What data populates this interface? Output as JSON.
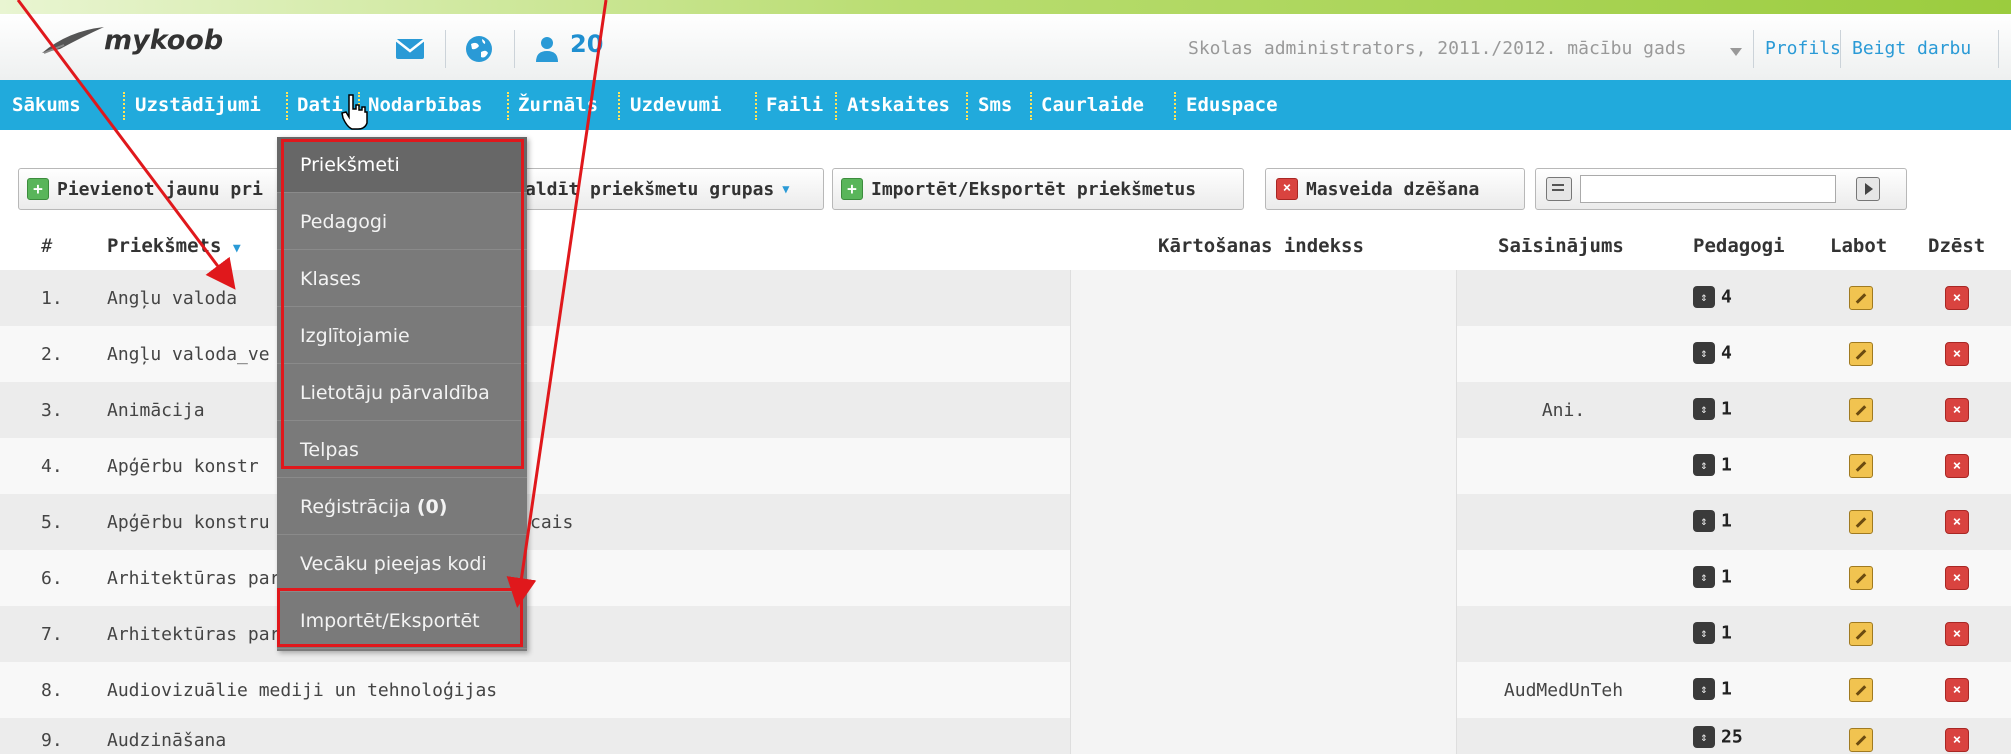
{
  "header": {
    "logo_text": "mykoob",
    "messages_icon": "envelope-icon",
    "globe_icon": "globe-icon",
    "users_icon": "users-icon",
    "users_count": "20",
    "account_text": "Skolas administrators, 2011./2012. mācību gads",
    "profile_link": "Profils",
    "logout_link": "Beigt darbu"
  },
  "nav": {
    "items": [
      "Sākums",
      "Uzstādījumi",
      "Dati",
      "Nodarbības",
      "Žurnāls",
      "Uzdevumi",
      "Faili",
      "Atskaites",
      "Sms",
      "Caurlaide",
      "Eduspace"
    ]
  },
  "toolbar": {
    "add_subject": "Pievienot jaunu pri",
    "manage_groups": "aldīt priekšmetu grupas",
    "import_export": "Importēt/Eksportēt priekšmetus",
    "mass_delete": "Masveida dzēšana",
    "filter_value": ""
  },
  "table": {
    "headers": {
      "num": "#",
      "subject": "Priekšmets",
      "sort_index": "Kārtošanas indekss",
      "abbreviation": "Saīsinājums",
      "teachers": "Pedagogi",
      "edit": "Labot",
      "delete": "Dzēst"
    },
    "rows": [
      {
        "num": "1.",
        "subject": "Angļu valoda",
        "abbr": "",
        "teachers": "4"
      },
      {
        "num": "2.",
        "subject": "Angļu valoda_ve",
        "abbr": "",
        "teachers": "4"
      },
      {
        "num": "3.",
        "subject": "Animācija",
        "abbr": "Ani.",
        "teachers": "1"
      },
      {
        "num": "4.",
        "subject": "Apģērbu konstr",
        "abbr": "",
        "teachers": "1"
      },
      {
        "num": "5.",
        "subject": "Apģērbu konstru",
        "subject_tail": "cais",
        "abbr": "",
        "teachers": "1"
      },
      {
        "num": "6.",
        "subject": "Arhitektūras par",
        "abbr": "",
        "teachers": "1"
      },
      {
        "num": "7.",
        "subject": "Arhitektūras par",
        "abbr": "",
        "teachers": "1"
      },
      {
        "num": "8.",
        "subject": "Audiovizuālie mediji un tehnoloģijas",
        "abbr": "AudMedUnTeh",
        "teachers": "1"
      },
      {
        "num": "9.",
        "subject": "Audzināšana",
        "abbr": "",
        "teachers": "25"
      }
    ]
  },
  "dropdown": {
    "items": [
      "Priekšmeti",
      "Pedagogi",
      "Klases",
      "Izglītojamie",
      "Lietotāju pārvaldība",
      "Telpas",
      "Reģistrācija",
      "Vecāku pieejas kodi",
      "Importēt/Eksportēt"
    ],
    "registration_count": "(0)"
  },
  "colors": {
    "nav_bg": "#21aadc",
    "link": "#2a9ad6",
    "annotation_red": "#e0181c",
    "dropdown_bg": "#7a7a7a"
  }
}
